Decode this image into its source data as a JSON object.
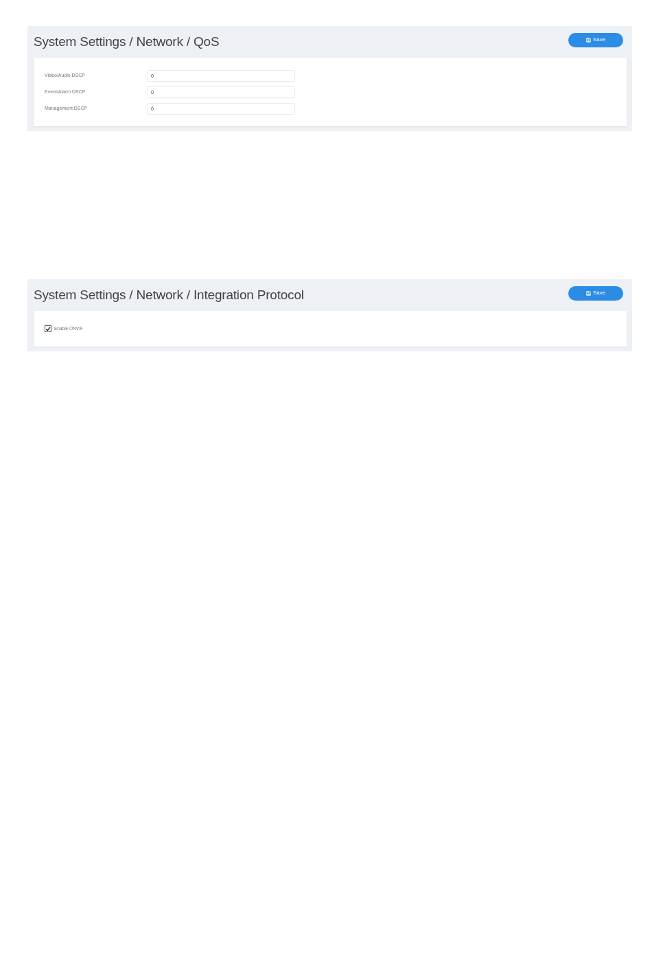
{
  "panels": [
    {
      "title": "System Settings / Network / QoS",
      "save_button": "Save",
      "fields": [
        {
          "kind": "text",
          "label": "Video/Audio DSCP",
          "value": "0"
        },
        {
          "kind": "text",
          "label": "Event/Alarm DSCP",
          "value": "0"
        },
        {
          "kind": "text",
          "label": "Management DSCP",
          "value": "0"
        }
      ]
    },
    {
      "title": "System Settings / Network / Integration Protocol",
      "save_button": "Save",
      "fields": [
        {
          "kind": "checkbox",
          "label": "Enable ONVIF",
          "checked": true
        }
      ]
    }
  ]
}
